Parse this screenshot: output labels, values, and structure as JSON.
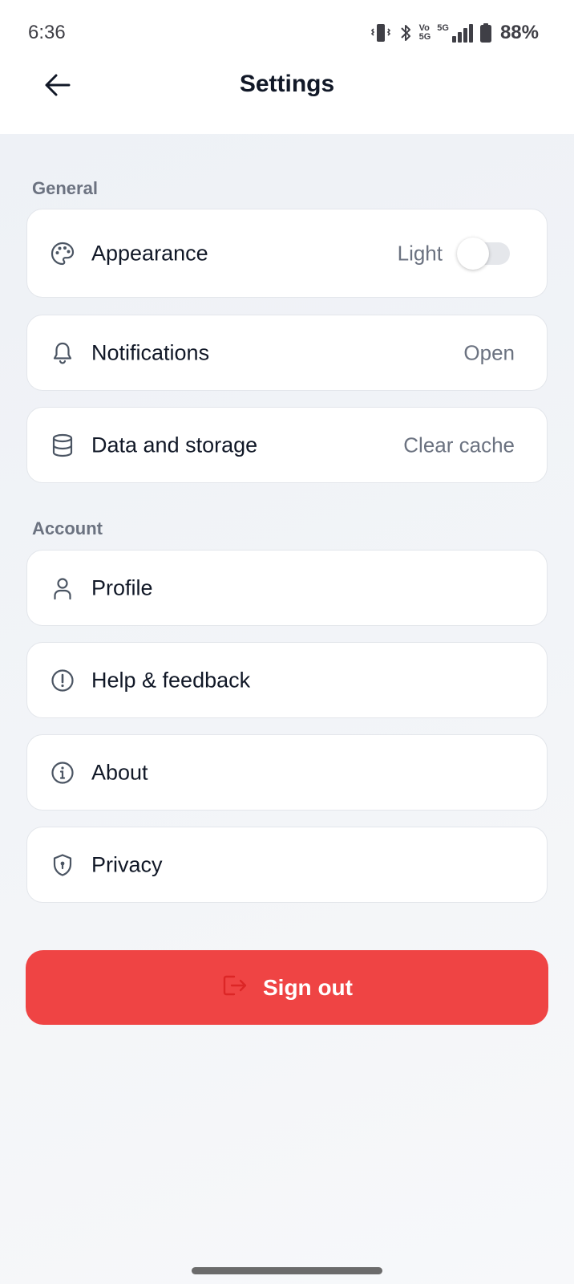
{
  "status_bar": {
    "time": "6:36",
    "battery_percent": "88%",
    "network_label_top": "Vo",
    "network_label_bottom": "5G",
    "signal_label": "5G",
    "icons": [
      "vibrate-icon",
      "bluetooth-icon",
      "volte-icon",
      "signal-icon",
      "battery-icon"
    ]
  },
  "header": {
    "back_icon": "arrow-left-icon",
    "title": "Settings"
  },
  "sections": {
    "general": {
      "label": "General",
      "items": [
        {
          "icon": "palette-icon",
          "label": "Appearance",
          "value": "Light",
          "toggle_on": false
        },
        {
          "icon": "bell-icon",
          "label": "Notifications",
          "value": "Open"
        },
        {
          "icon": "database-icon",
          "label": "Data and storage",
          "value": "Clear cache"
        }
      ]
    },
    "account": {
      "label": "Account",
      "items": [
        {
          "icon": "user-icon",
          "label": "Profile"
        },
        {
          "icon": "alert-circle-icon",
          "label": "Help & feedback"
        },
        {
          "icon": "info-icon",
          "label": "About"
        },
        {
          "icon": "shield-lock-icon",
          "label": "Privacy"
        }
      ]
    }
  },
  "sign_out": {
    "icon": "log-out-icon",
    "label": "Sign out",
    "background_color": "#ef4444",
    "icon_color": "#dc2626"
  },
  "colors": {
    "text_primary": "#111827",
    "text_secondary": "#6b7280",
    "icon_gray": "#4b5563",
    "page_background": "#eef1f6",
    "card_border": "#e3e6eb"
  }
}
